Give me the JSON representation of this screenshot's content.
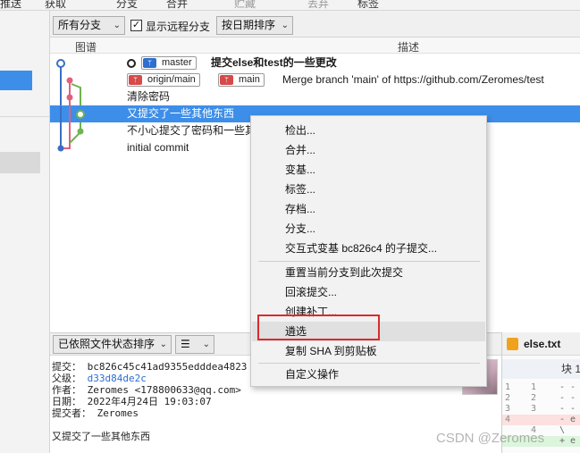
{
  "toolbar": {
    "items": [
      "推送",
      "获取",
      "分支",
      "合并",
      "贮藏",
      "丢弃",
      "标签"
    ]
  },
  "filter": {
    "branches_select": "所有分支",
    "show_remote_label": "显示远程分支",
    "show_remote_checked": true,
    "sort_select": "按日期排序"
  },
  "columns": {
    "graph": "图谱",
    "description": "描述"
  },
  "commits": [
    {
      "message": "提交else和test的一些更改",
      "branches": [
        {
          "name": "master",
          "kind": "local",
          "icon": "branch-icon"
        }
      ],
      "is_head": true
    },
    {
      "message": "Merge branch 'main' of https://github.com/Zeromes/test",
      "branches": [
        {
          "name": "origin/main",
          "kind": "remote",
          "icon": "branch-icon"
        },
        {
          "name": "main",
          "kind": "local",
          "icon": "branch-icon"
        }
      ]
    },
    {
      "message": "清除密码"
    },
    {
      "message": "又提交了一些其他东西",
      "selected": true
    },
    {
      "message": "不小心提交了密码和一些其"
    },
    {
      "message": "initial commit"
    }
  ],
  "context_menu": {
    "items": [
      "检出...",
      "合并...",
      "变基...",
      "标签...",
      "存档...",
      "分支...",
      "交互式变基 bc826c4 的子提交...",
      "重置当前分支到此次提交",
      "回滚提交...",
      "创建补丁...",
      "遴选",
      "复制 SHA 到剪贴板",
      "自定义操作"
    ],
    "highlighted_item": "遴选"
  },
  "bottom": {
    "file_sort_select": "已依照文件状态排序",
    "view_icon": "list-lines-icon"
  },
  "commit_details": {
    "commit_label": "提交：",
    "commit_value": "bc826c45c41ad9355edddea4823",
    "parent_label": "父级：",
    "parent_value": "d33d84de2c",
    "author_label": "作者：",
    "author_value": "Zeromes <178800633@qq.com>",
    "date_label": "日期：",
    "date_value": "2022年4月24日 19:03:07",
    "committer_label": "提交者：",
    "committer_value": "Zeromes",
    "message": "又提交了一些其他东西"
  },
  "diff": {
    "file_name": "else.txt",
    "hunk_label": "块 1",
    "lines": [
      {
        "old": "1",
        "new": "1",
        "text": "- - -e",
        "kind": "ctx"
      },
      {
        "old": "2",
        "new": "2",
        "text": "- - -e",
        "kind": "ctx"
      },
      {
        "old": "3",
        "new": "3",
        "text": "- - -e",
        "kind": "ctx"
      },
      {
        "old": "4",
        "new": "",
        "text": "- e",
        "kind": "del"
      },
      {
        "old": "",
        "new": "4",
        "text": "\\",
        "kind": "ctx"
      },
      {
        "old": "",
        "new": "",
        "text": "+ e",
        "kind": "add"
      }
    ]
  },
  "watermark": "CSDN @Zeromes",
  "colors": {
    "selection": "#3d8ee9",
    "branch_local": "#2f6fcf",
    "branch_remote": "#d64a4a",
    "graph_blue": "#3a6fc4",
    "graph_pink": "#e0607e",
    "graph_green": "#6fb34f",
    "highlight_box": "#d92b2b"
  }
}
